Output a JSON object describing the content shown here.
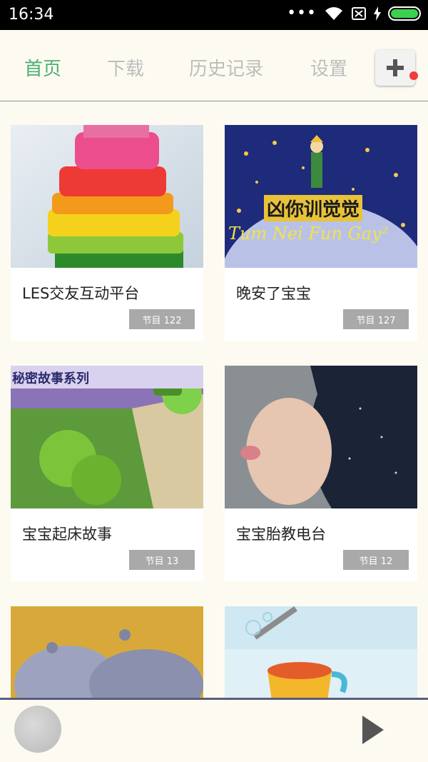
{
  "status": {
    "time": "16:34"
  },
  "tabs": [
    {
      "label": "首页",
      "active": true
    },
    {
      "label": "下载",
      "active": false
    },
    {
      "label": "历史记录",
      "active": false
    },
    {
      "label": "设置",
      "active": false
    }
  ],
  "add_button": {
    "icon": "plus-icon",
    "has_notification": true
  },
  "cards": [
    {
      "title": "LES交友互动平台",
      "badge": "节目 122",
      "thumb": "rainbow-cake"
    },
    {
      "title": "晚安了宝宝",
      "badge": "节目 127",
      "thumb": "little-prince-night"
    },
    {
      "title": "宝宝起床故事",
      "badge": "节目 13",
      "thumb": "plants-vs-zombies-book"
    },
    {
      "title": "宝宝胎教电台",
      "badge": "节目 12",
      "thumb": "baby-in-hood"
    },
    {
      "title": "",
      "badge": "",
      "thumb": "hippos"
    },
    {
      "title": "",
      "badge": "",
      "thumb": "cup-straw-cartoon"
    }
  ],
  "thumb_texts": {
    "little_prince_cn": "凶你训觉觉",
    "little_prince_en": "Tum Nei Fun Gay²",
    "pvz_banner": "秘密故事系列"
  },
  "player": {
    "play_icon": "play-icon"
  },
  "colors": {
    "accent": "#4caf73",
    "inactive_tab": "#bdbdbd",
    "badge": "#a9a9a9",
    "background": "#fdfbf1"
  }
}
